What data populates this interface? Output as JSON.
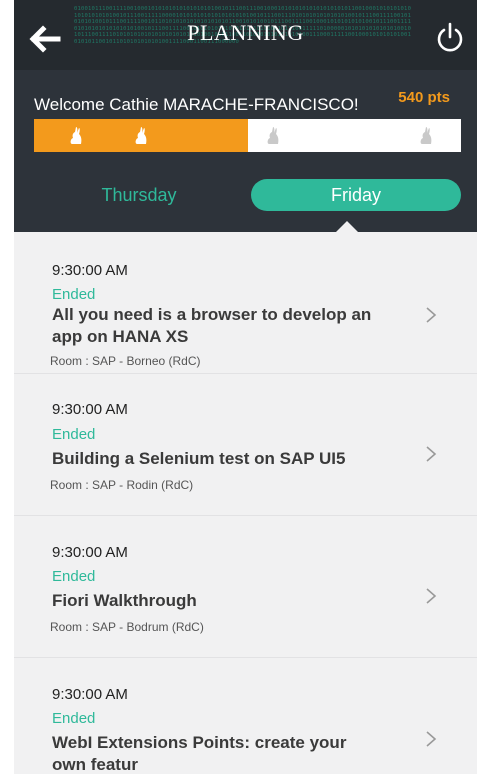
{
  "header": {
    "title": "PLANNING",
    "binary_text": "01001011100111100100010101010101010101010010111001110010001010101010101010101011001000101010101010101010101001011100111110000101010101010101010101001011100111010101010101010100101110011110010101010100101110011110010110101010101010101010110010101001011100111100100010101010101001011100111101010101010101010100101110011110010101010101010101010101001011100111110100000101010101010101001010111001111010101010101010101010101010010101100110101010101010101001110001111100100010101010100101010110010110101010101010011110001100111000000"
  },
  "welcome": {
    "text": "Welcome Cathie MARACHE-FRANCISCO!",
    "points": "540 pts",
    "progress_fraction": 0.5,
    "accent_color": "#f39a1c"
  },
  "tabs": [
    {
      "label": "Thursday",
      "active": false
    },
    {
      "label": "Friday",
      "active": true
    }
  ],
  "sessions": [
    {
      "time": "9:30:00 AM",
      "status": "Ended",
      "title": "All you need is a browser to develop an app on HANA XS",
      "room": "Room : SAP - Borneo (RdC)"
    },
    {
      "time": "9:30:00 AM",
      "status": "Ended",
      "title": "Building a Selenium test on SAP UI5",
      "room": "Room : SAP - Rodin (RdC)"
    },
    {
      "time": "9:30:00 AM",
      "status": "Ended",
      "title": "Fiori Walkthrough",
      "room": "Room : SAP - Bodrum (RdC)"
    },
    {
      "time": "9:30:00 AM",
      "status": "Ended",
      "title": "WebI Extensions Points: create your own featur",
      "room": ""
    }
  ],
  "colors": {
    "green": "#2fb99a",
    "orange": "#f39a1c",
    "dark": "#252a2f"
  },
  "icons": {
    "back": "arrow-left-icon",
    "power": "power-icon",
    "chevron": "chevron-right-icon",
    "rabbit": "rabbit-icon"
  }
}
